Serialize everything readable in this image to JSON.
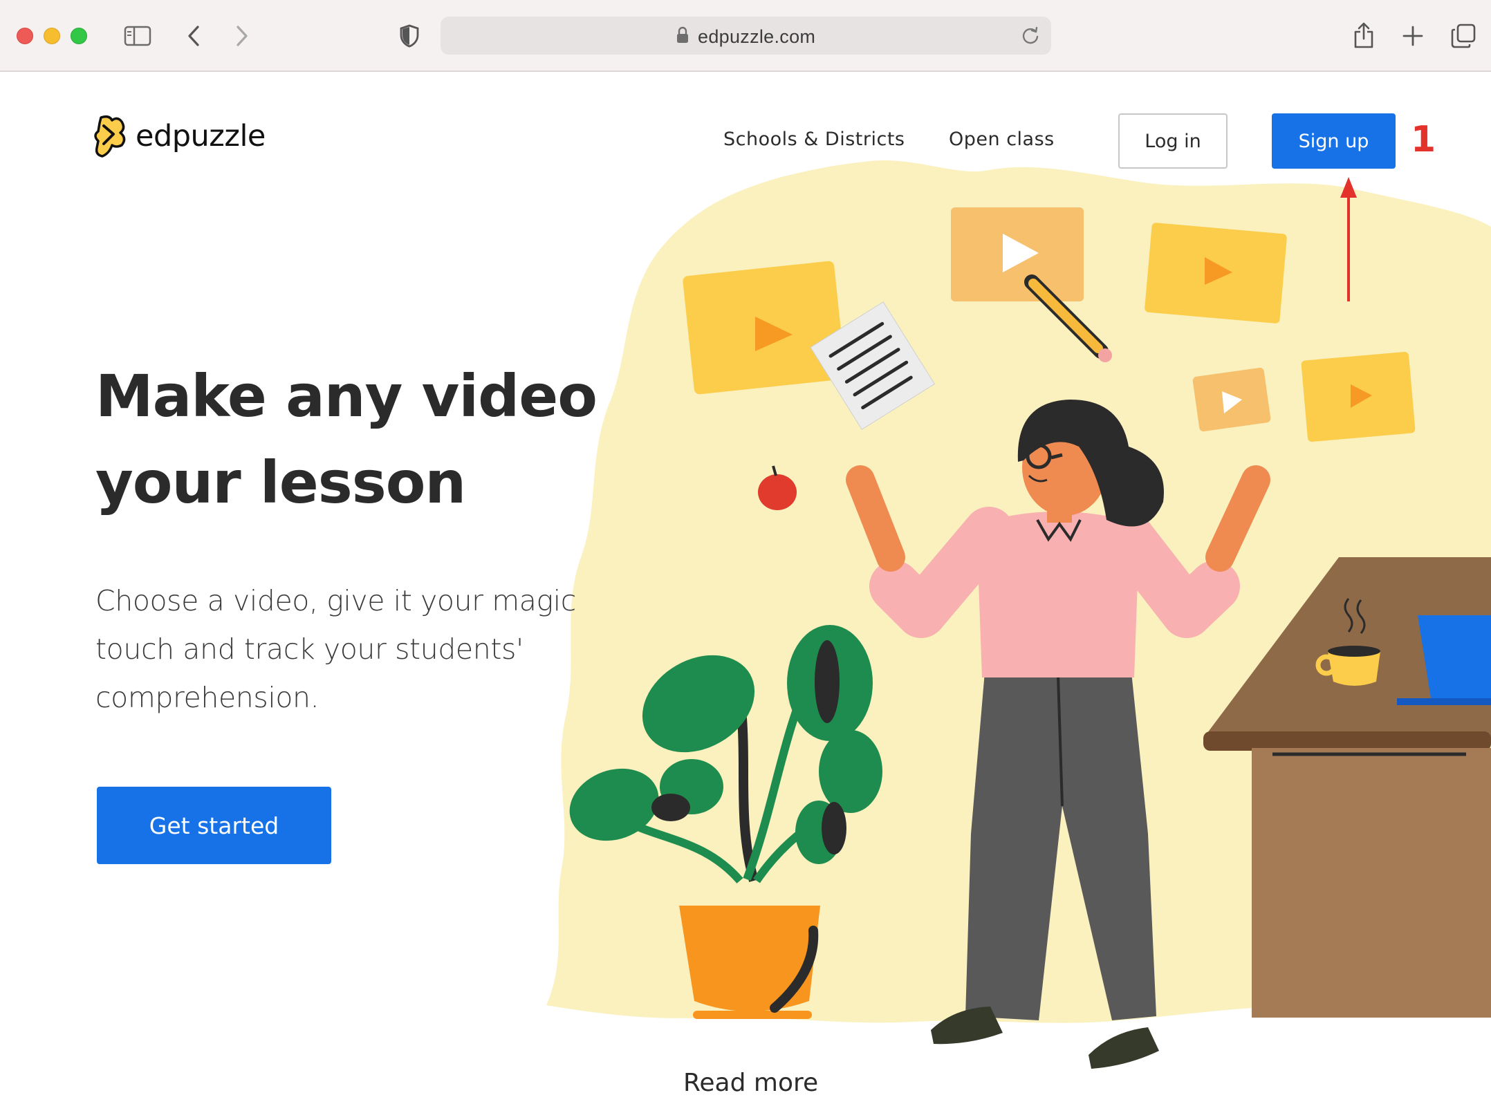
{
  "browser": {
    "url": "edpuzzle.com",
    "colors": {
      "close": "#ee5a55",
      "minimize": "#f6be2f",
      "zoom": "#33c748"
    },
    "icons": [
      "sidebar-icon",
      "back-icon",
      "forward-icon",
      "privacy-shield-icon",
      "lock-icon",
      "reload-icon",
      "share-icon",
      "new-tab-icon",
      "tabs-overview-icon"
    ]
  },
  "header": {
    "logo_text": "edpuzzle",
    "nav": {
      "schools": "Schools & Districts",
      "open_class": "Open class"
    },
    "login_label": "Log in",
    "signup_label": "Sign up"
  },
  "annotation": {
    "step": "1",
    "color": "#e3322b"
  },
  "hero": {
    "title_line1": "Make any video",
    "title_line2": "your lesson",
    "subtitle_line1": "Choose a video, give it your magic",
    "subtitle_line2": "touch and track your students'",
    "subtitle_line3": "comprehension.",
    "cta_label": "Get started"
  },
  "footer": {
    "read_more": "Read more"
  },
  "colors": {
    "brand_blue": "#1672e6",
    "accent_yellow": "#fbcd4a",
    "blob": "#faf1bf"
  }
}
